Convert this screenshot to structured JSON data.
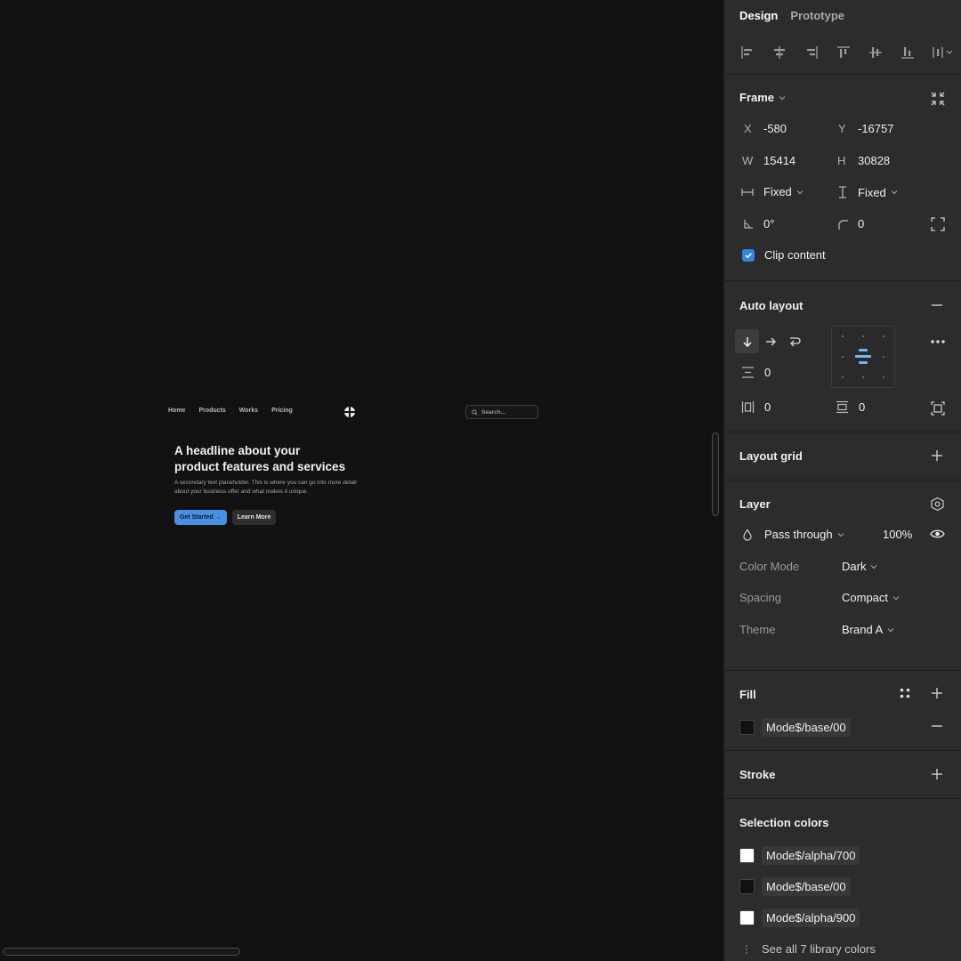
{
  "site": {
    "nav": [
      "Home",
      "Products",
      "Works",
      "Pricing"
    ],
    "search_placeholder": "Search...",
    "headline_line1": "A headline about your",
    "headline_line2": "product features and services",
    "sub_line1": "A secondary text placeholder. This is where you can go into more detail",
    "sub_line2": "about your business offer and what makes it unique.",
    "primary_button": "Get Started →",
    "secondary_button": "Learn More"
  },
  "panel": {
    "tabs": [
      "Design",
      "Prototype"
    ],
    "frame": {
      "title": "Frame",
      "x_label": "X",
      "x_value": "-580",
      "y_label": "Y",
      "y_value": "-16757",
      "w_label": "W",
      "w_value": "15414",
      "h_label": "H",
      "h_value": "30828",
      "h_resize": "Fixed",
      "v_resize": "Fixed",
      "rotation": "0°",
      "radius": "0",
      "clip_content_label": "Clip content",
      "clip_content": true
    },
    "auto_layout": {
      "title": "Auto layout",
      "gap": "0",
      "h_padding": "0",
      "v_padding": "0"
    },
    "layout_grid": {
      "title": "Layout grid"
    },
    "layer": {
      "title": "Layer",
      "blend": "Pass through",
      "opacity": "100%",
      "props": [
        {
          "label": "Color Mode",
          "value": "Dark"
        },
        {
          "label": "Spacing",
          "value": "Compact"
        },
        {
          "label": "Theme",
          "value": "Brand A"
        }
      ]
    },
    "fill": {
      "title": "Fill",
      "token": "Mode$/base/00",
      "color": "#111111"
    },
    "stroke": {
      "title": "Stroke"
    },
    "selection_colors": {
      "title": "Selection colors",
      "items": [
        {
          "token": "Mode$/alpha/700",
          "color": "#ffffff"
        },
        {
          "token": "Mode$/base/00",
          "color": "#111111"
        },
        {
          "token": "Mode$/alpha/900",
          "color": "#ffffff"
        }
      ],
      "see_all": "See all 7 library colors"
    }
  },
  "colors": {
    "canvas": "#121212",
    "panel": "#2c2c2c",
    "accent": "#2f86e6"
  }
}
